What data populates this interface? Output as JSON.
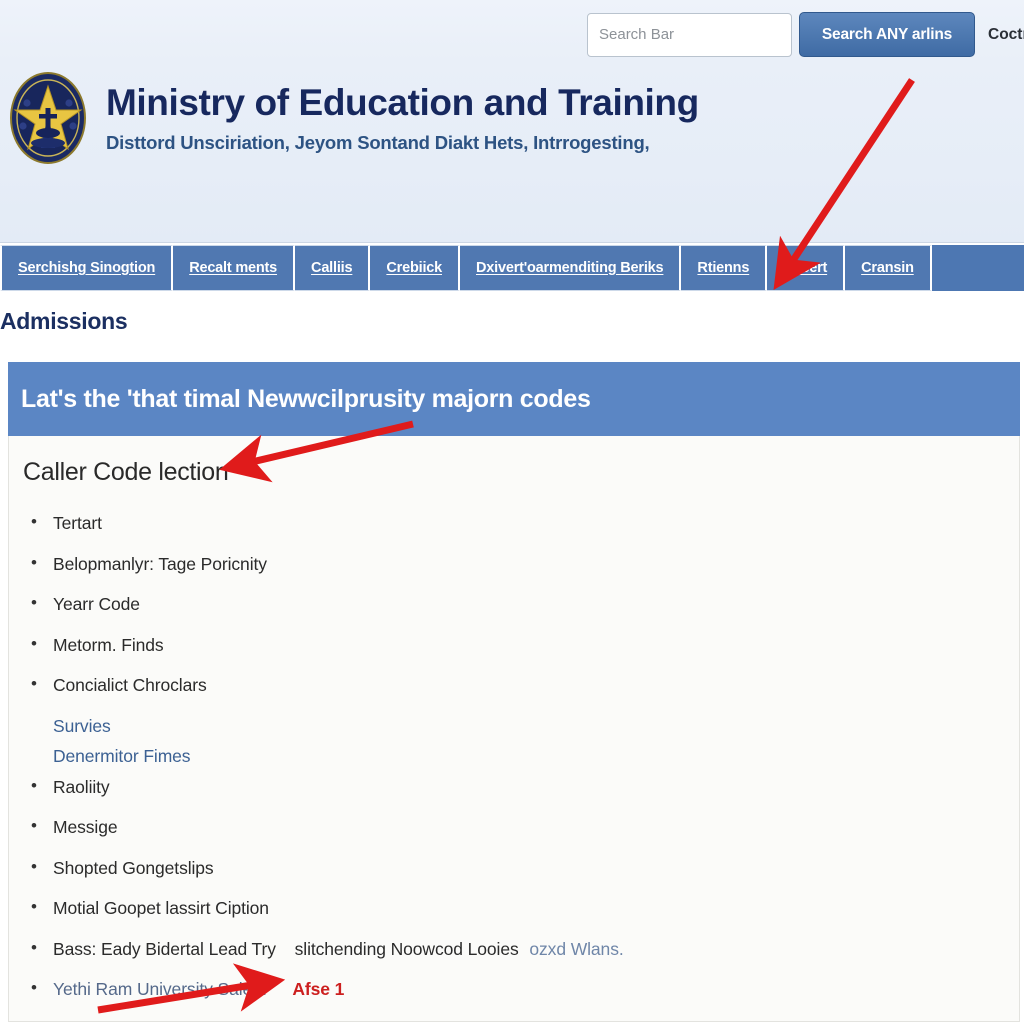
{
  "topbar": {
    "search_placeholder": "Search Bar",
    "search_value": "",
    "search_button_label": "Search ANY arlins",
    "extra_label": "Coctr"
  },
  "masthead": {
    "title": "Ministry of Education and Training",
    "subtitle": "Disttord Unsciriation, Jeyom Sontand Diakt Hets, Intrrogesting,",
    "emblem_alt": "ministry-seal"
  },
  "nav": {
    "items": [
      {
        "label": "Serchishg Sinogtion"
      },
      {
        "label": "Recalt ments"
      },
      {
        "label": "Calliis"
      },
      {
        "label": "Crebiick"
      },
      {
        "label": "Dxivert'oarmenditing Beriks"
      },
      {
        "label": "Rtienns"
      },
      {
        "label": "Resert"
      },
      {
        "label": "Cransin"
      }
    ]
  },
  "page": {
    "title": "Admissions"
  },
  "banner": {
    "text": "Lat's the 'that timal Newwcilprusity majorn codes"
  },
  "content": {
    "section_title": "Caller Code lection",
    "items": [
      {
        "text": "Tertart",
        "type": "bullet"
      },
      {
        "text": "Belopmanlyr: Tage Poricnity",
        "type": "bullet"
      },
      {
        "text": "Yearr Code",
        "type": "bullet"
      },
      {
        "text": "Metorm. Finds",
        "type": "bullet"
      },
      {
        "text": "Concialict Chroclars",
        "type": "bullet"
      },
      {
        "text": "Survies",
        "type": "sublink"
      },
      {
        "text": "Denermitor Fimes",
        "type": "sublink"
      },
      {
        "text": "Raoliity",
        "type": "bullet"
      },
      {
        "text": "Messige",
        "type": "bullet"
      },
      {
        "text": "Shopted Gongetslips",
        "type": "bullet"
      },
      {
        "text": "Motial Goopet lassirt Ciption",
        "type": "bullet"
      }
    ],
    "long_item": {
      "lead": "Bass: Eady Bidertal Lead Try",
      "mid": "slitchending Noowcod Looies",
      "tail": "ozxd Wlans."
    },
    "last_item": {
      "text": "Yethi Ram University Salest",
      "badge": "Afse 1"
    }
  },
  "annotations": {
    "arrow_1_target": "nav-item-rtienns",
    "arrow_2_target": "section-title-caller-code-lection",
    "arrow_3_target": "last-list-item",
    "color": "#e01b1b"
  },
  "colors": {
    "nav_blue": "#5078b1",
    "banner_blue": "#5b86c4",
    "brand_navy": "#17285e",
    "accent_red": "#cc1f1f",
    "link_blue": "#3c6193",
    "header_bg": "#e9eff8"
  }
}
